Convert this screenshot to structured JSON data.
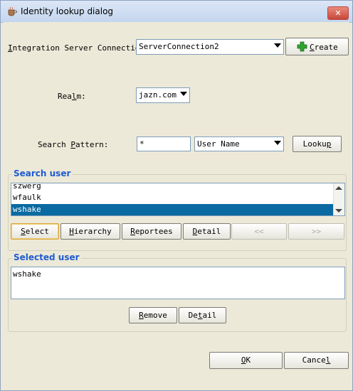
{
  "window": {
    "title": "Identity lookup dialog",
    "close_label": "✕"
  },
  "connection": {
    "label_pre": "",
    "label_u": "I",
    "label_post": "ntegration Server Connection",
    "value": "ServerConnection2",
    "create_pre": "",
    "create_u": "C",
    "create_post": "reate"
  },
  "realm": {
    "label_pre": "Rea",
    "label_u": "l",
    "label_post": "m:",
    "value": "jazn.com"
  },
  "search": {
    "label_pre": "Search ",
    "label_u": "P",
    "label_post": "attern:",
    "value": "*",
    "type_value": "User Name",
    "lookup_pre": "Looku",
    "lookup_u": "p",
    "lookup_post": ""
  },
  "search_user": {
    "title": "Search user",
    "items": [
      {
        "label": "szwerg",
        "selected": false
      },
      {
        "label": "wfaulk",
        "selected": false
      },
      {
        "label": "wshake",
        "selected": true
      }
    ],
    "buttons": {
      "select_pre": "",
      "select_u": "S",
      "select_post": "elect",
      "hierarchy_pre": "",
      "hierarchy_u": "H",
      "hierarchy_post": "ierarchy",
      "reportees_pre": "",
      "reportees_u": "R",
      "reportees_post": "eportees",
      "detail_pre": "",
      "detail_u": "D",
      "detail_post": "etail",
      "prev": "<<",
      "next": ">>"
    }
  },
  "selected_user": {
    "title": "Selected user",
    "value": "wshake",
    "remove_pre": "",
    "remove_u": "R",
    "remove_post": "emove",
    "detail_pre": "De",
    "detail_u": "t",
    "detail_post": "ail"
  },
  "footer": {
    "ok_pre": "",
    "ok_u": "O",
    "ok_post": "K",
    "cancel_pre": "Cance",
    "cancel_u": "l",
    "cancel_post": ""
  },
  "colors": {
    "selection": "#0a6aa1",
    "group_title": "#1f5bd1",
    "create_plus": "#2fa32f"
  }
}
